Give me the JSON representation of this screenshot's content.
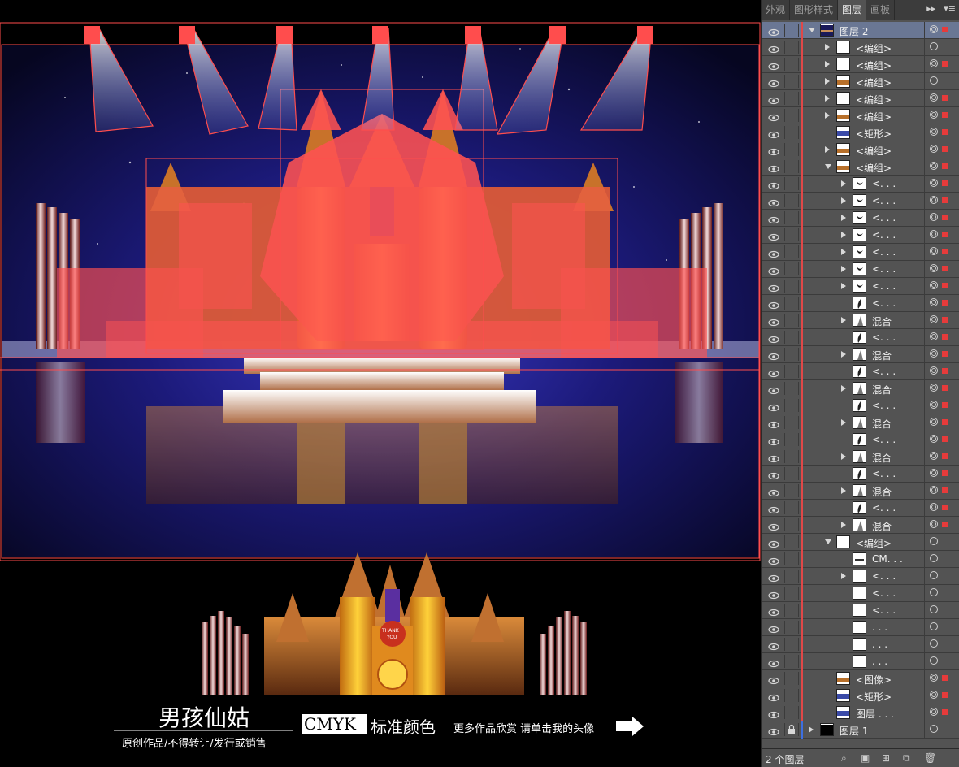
{
  "panel": {
    "tabs": [
      {
        "label": "外观",
        "active": false
      },
      {
        "label": "图形样式",
        "active": false
      },
      {
        "label": "图层",
        "active": true
      },
      {
        "label": "画板",
        "active": false
      }
    ],
    "layers": [
      {
        "label": "图层 2",
        "indent": 0,
        "expand": "down",
        "selected": true,
        "circle": "dbl",
        "sq": true,
        "thumb": "dark"
      },
      {
        "label": "<编组>",
        "indent": 1,
        "expand": "right",
        "circle": "single",
        "sq": false,
        "thumb": "white"
      },
      {
        "label": "<编组>",
        "indent": 1,
        "expand": "right",
        "circle": "dbl",
        "sq": true,
        "thumb": "white"
      },
      {
        "label": "<编组>",
        "indent": 1,
        "expand": "right",
        "circle": "single",
        "sq": false,
        "thumb": "stage"
      },
      {
        "label": "<编组>",
        "indent": 1,
        "expand": "right",
        "circle": "dbl",
        "sq": true,
        "thumb": "white"
      },
      {
        "label": "<编组>",
        "indent": 1,
        "expand": "right",
        "circle": "dbl",
        "sq": true,
        "thumb": "stage"
      },
      {
        "label": "<矩形>",
        "indent": 1,
        "expand": "none",
        "circle": "dbl",
        "sq": true,
        "thumb": "blue"
      },
      {
        "label": "<编组>",
        "indent": 1,
        "expand": "right",
        "circle": "dbl",
        "sq": true,
        "thumb": "stage"
      },
      {
        "label": "<编组>",
        "indent": 1,
        "expand": "down",
        "circle": "dbl",
        "sq": true,
        "thumb": "stage"
      },
      {
        "label": "<. . .",
        "indent": 2,
        "expand": "right",
        "circle": "dbl",
        "sq": true,
        "thumb": "drop"
      },
      {
        "label": "<. . .",
        "indent": 2,
        "expand": "right",
        "circle": "dbl",
        "sq": true,
        "thumb": "drop"
      },
      {
        "label": "<. . .",
        "indent": 2,
        "expand": "right",
        "circle": "dbl",
        "sq": true,
        "thumb": "drop"
      },
      {
        "label": "<. . .",
        "indent": 2,
        "expand": "right",
        "circle": "dbl",
        "sq": true,
        "thumb": "drop"
      },
      {
        "label": "<. . .",
        "indent": 2,
        "expand": "right",
        "circle": "dbl",
        "sq": true,
        "thumb": "drop"
      },
      {
        "label": "<. . .",
        "indent": 2,
        "expand": "right",
        "circle": "dbl",
        "sq": true,
        "thumb": "drop"
      },
      {
        "label": "<. . .",
        "indent": 2,
        "expand": "right",
        "circle": "dbl",
        "sq": true,
        "thumb": "drop"
      },
      {
        "label": "<. . .",
        "indent": 2,
        "expand": "none",
        "circle": "dbl",
        "sq": true,
        "thumb": "leaf"
      },
      {
        "label": "混合",
        "indent": 2,
        "expand": "right",
        "circle": "dbl",
        "sq": true,
        "thumb": "blend"
      },
      {
        "label": "<. . .",
        "indent": 2,
        "expand": "none",
        "circle": "dbl",
        "sq": true,
        "thumb": "leaf"
      },
      {
        "label": "混合",
        "indent": 2,
        "expand": "right",
        "circle": "dbl",
        "sq": true,
        "thumb": "blend"
      },
      {
        "label": "<. . .",
        "indent": 2,
        "expand": "none",
        "circle": "dbl",
        "sq": true,
        "thumb": "leaf"
      },
      {
        "label": "混合",
        "indent": 2,
        "expand": "right",
        "circle": "dbl",
        "sq": true,
        "thumb": "blend"
      },
      {
        "label": "<. . .",
        "indent": 2,
        "expand": "none",
        "circle": "dbl",
        "sq": true,
        "thumb": "leaf"
      },
      {
        "label": "混合",
        "indent": 2,
        "expand": "right",
        "circle": "dbl",
        "sq": true,
        "thumb": "blend"
      },
      {
        "label": "<. . .",
        "indent": 2,
        "expand": "none",
        "circle": "dbl",
        "sq": true,
        "thumb": "leaf"
      },
      {
        "label": "混合",
        "indent": 2,
        "expand": "right",
        "circle": "dbl",
        "sq": true,
        "thumb": "blend"
      },
      {
        "label": "<. . .",
        "indent": 2,
        "expand": "none",
        "circle": "dbl",
        "sq": true,
        "thumb": "leaf"
      },
      {
        "label": "混合",
        "indent": 2,
        "expand": "right",
        "circle": "dbl",
        "sq": true,
        "thumb": "blend"
      },
      {
        "label": "<. . .",
        "indent": 2,
        "expand": "none",
        "circle": "dbl",
        "sq": true,
        "thumb": "leaf"
      },
      {
        "label": "混合",
        "indent": 2,
        "expand": "right",
        "circle": "dbl",
        "sq": true,
        "thumb": "blend"
      },
      {
        "label": "<编组>",
        "indent": 1,
        "expand": "down",
        "circle": "single",
        "sq": false,
        "thumb": "white"
      },
      {
        "label": "CM. . .",
        "indent": 2,
        "expand": "none",
        "circle": "single",
        "sq": false,
        "thumb": "line"
      },
      {
        "label": "<. . .",
        "indent": 2,
        "expand": "right",
        "circle": "single",
        "sq": false,
        "thumb": "white"
      },
      {
        "label": "<. . .",
        "indent": 2,
        "expand": "none",
        "circle": "single",
        "sq": false,
        "thumb": "white"
      },
      {
        "label": "<. . .",
        "indent": 2,
        "expand": "none",
        "circle": "single",
        "sq": false,
        "thumb": "white"
      },
      {
        "label": ". . .",
        "indent": 2,
        "expand": "none",
        "circle": "single",
        "sq": false,
        "thumb": "white"
      },
      {
        "label": ". . .",
        "indent": 2,
        "expand": "none",
        "circle": "single",
        "sq": false,
        "thumb": "white"
      },
      {
        "label": ". . .",
        "indent": 2,
        "expand": "none",
        "circle": "single",
        "sq": false,
        "thumb": "white"
      },
      {
        "label": "<图像>",
        "indent": 1,
        "expand": "none",
        "circle": "dbl",
        "sq": true,
        "thumb": "stage"
      },
      {
        "label": "<矩形>",
        "indent": 1,
        "expand": "none",
        "circle": "dbl",
        "sq": true,
        "thumb": "blue"
      },
      {
        "label": "图层 . . .",
        "indent": 1,
        "expand": "none",
        "circle": "dbl",
        "sq": true,
        "thumb": "blue"
      },
      {
        "label": "图层 1",
        "indent": 0,
        "expand": "right",
        "circle": "single",
        "sq": false,
        "thumb": "black",
        "locked": true,
        "color": "blue"
      }
    ],
    "status_count": "2 个图层"
  },
  "artwork": {
    "brand_name": "男孩仙姑",
    "brand_sub": "原创作品/不得转让/发行或销售",
    "cmyk_label": "CMYK",
    "std_color": "标准颜色",
    "more_works": "更多作品欣赏 请单击我的头像",
    "badge_line1": "THANK",
    "badge_line2": "YOU"
  },
  "colors": {
    "selection": "#ff4d4d",
    "panel_bg": "#535353",
    "panel_selected": "#6a7794"
  }
}
